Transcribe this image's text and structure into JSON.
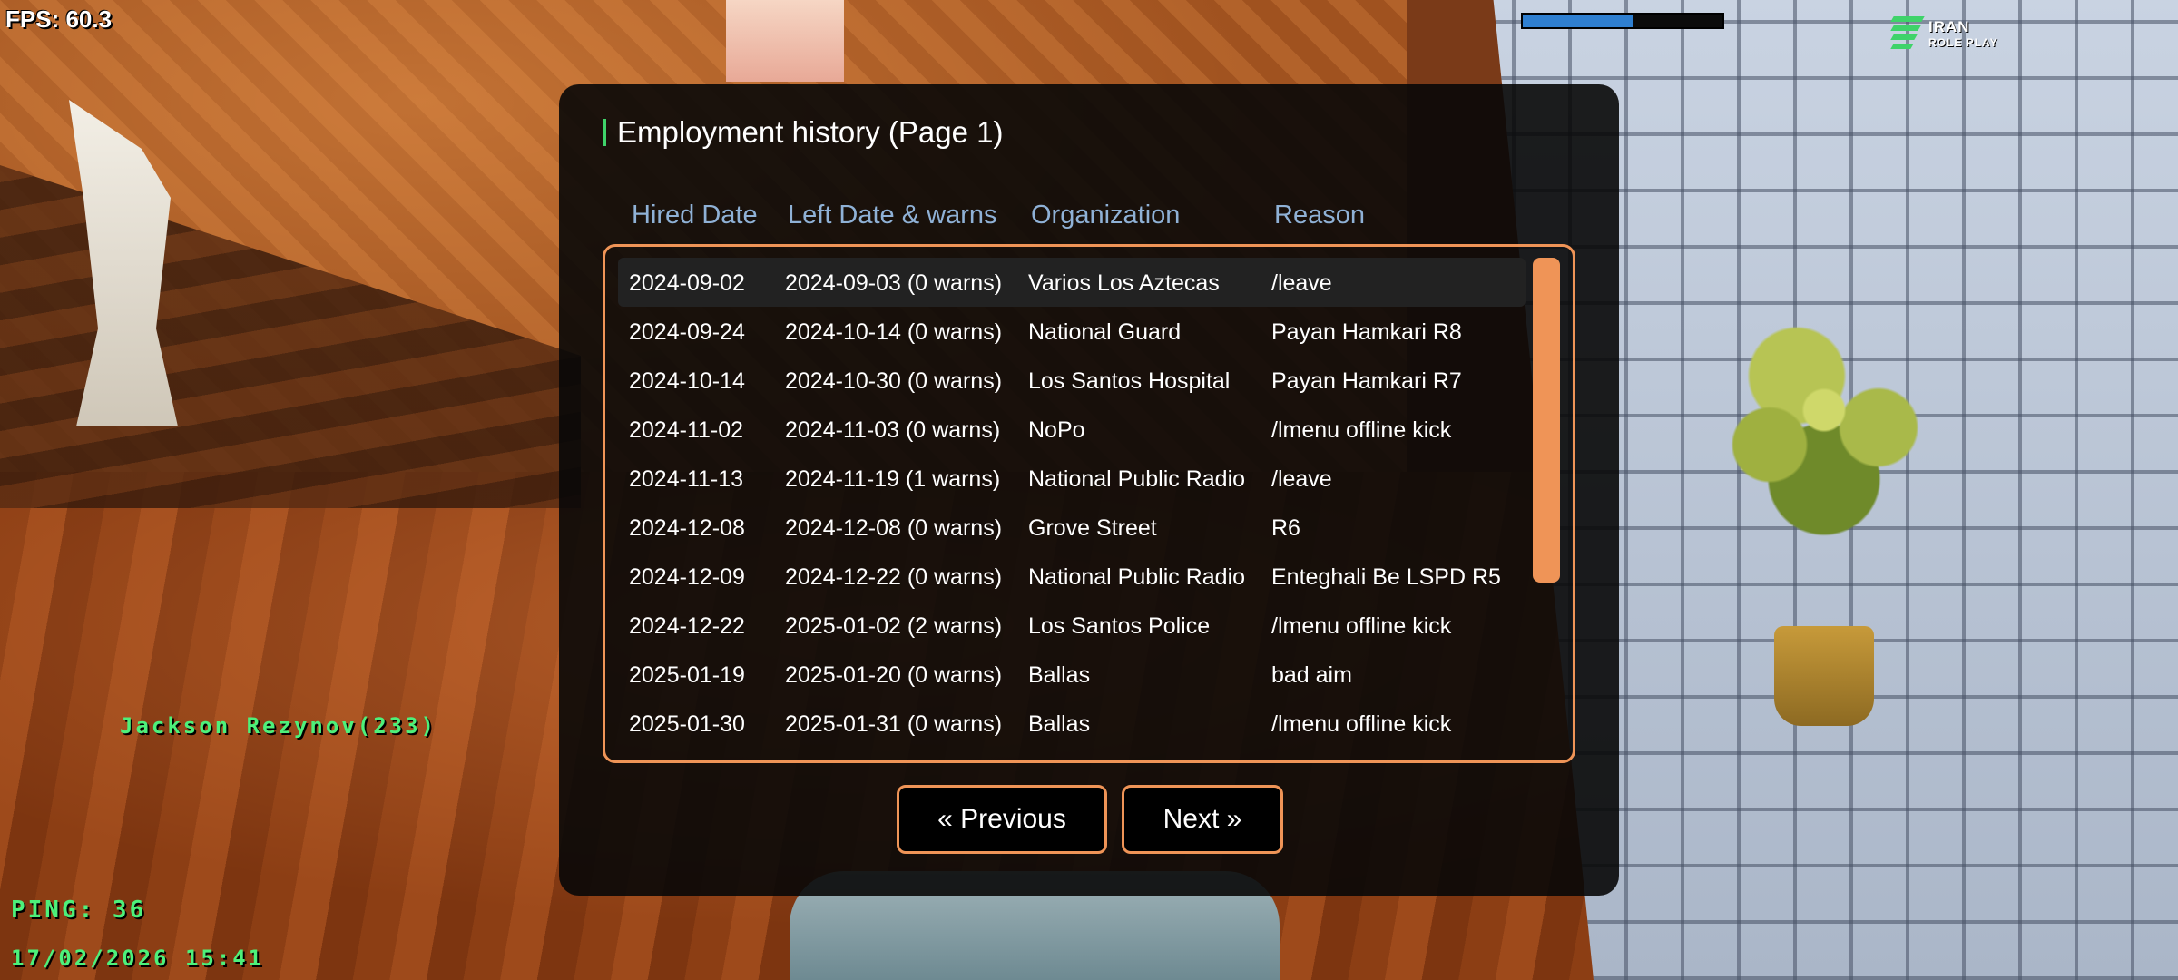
{
  "hud": {
    "fps": "FPS: 60.3",
    "health_fraction": 0.55,
    "logo_line1": "IRAN",
    "logo_line2": "ROLE PLAY",
    "player_name": "Jackson Rezynov(233)",
    "ping": "PING: 36",
    "datetime": "17/02/2026 15:41"
  },
  "dialog": {
    "title": "Employment history (Page 1)",
    "columns": [
      "Hired Date",
      "Left Date & warns",
      "Organization",
      "Reason"
    ],
    "rows": [
      {
        "hired": "2024-09-02",
        "left": "2024-09-03 (0 warns)",
        "org": "Varios Los Aztecas",
        "reason": "/leave"
      },
      {
        "hired": "2024-09-24",
        "left": "2024-10-14 (0 warns)",
        "org": "National Guard",
        "reason": "Payan Hamkari R8"
      },
      {
        "hired": "2024-10-14",
        "left": "2024-10-30 (0 warns)",
        "org": "Los Santos Hospital",
        "reason": "Payan Hamkari R7"
      },
      {
        "hired": "2024-11-02",
        "left": "2024-11-03 (0 warns)",
        "org": "NoPo",
        "reason": "/lmenu offline kick"
      },
      {
        "hired": "2024-11-13",
        "left": "2024-11-19 (1 warns)",
        "org": "National Public Radio",
        "reason": "/leave"
      },
      {
        "hired": "2024-12-08",
        "left": "2024-12-08 (0 warns)",
        "org": "Grove Street",
        "reason": "R6"
      },
      {
        "hired": "2024-12-09",
        "left": "2024-12-22 (0 warns)",
        "org": "National Public Radio",
        "reason": "Enteghali Be LSPD R5"
      },
      {
        "hired": "2024-12-22",
        "left": "2025-01-02 (2 warns)",
        "org": "Los Santos Police",
        "reason": "/lmenu offline kick"
      },
      {
        "hired": "2025-01-19",
        "left": "2025-01-20 (0 warns)",
        "org": "Ballas",
        "reason": "bad aim"
      },
      {
        "hired": "2025-01-30",
        "left": "2025-01-31 (0 warns)",
        "org": "Ballas",
        "reason": "/lmenu offline kick"
      }
    ],
    "prev_label": "« Previous",
    "next_label": "Next »"
  },
  "colors": {
    "accent_orange": "#ef9457",
    "header_blue": "#8fb1d6",
    "hud_green": "#4df07a",
    "title_accent_green": "#3fd36a",
    "health_blue": "#2f7fd0"
  }
}
